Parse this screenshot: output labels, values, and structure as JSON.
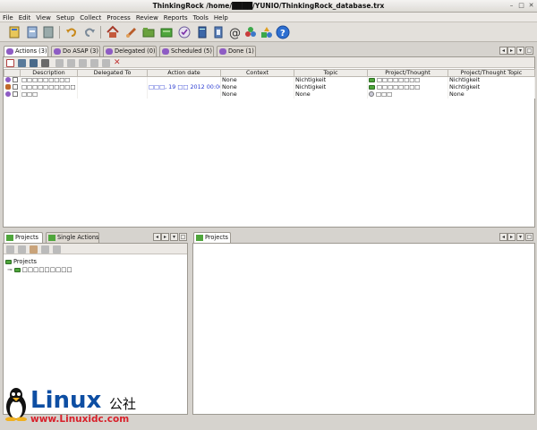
{
  "window": {
    "title": "ThinkingRock /home/████/YUNIO/ThinkingRock_database.trx"
  },
  "menu": [
    "File",
    "Edit",
    "View",
    "Setup",
    "Collect",
    "Process",
    "Review",
    "Reports",
    "Tools",
    "Help"
  ],
  "toolbar_icons": [
    "collect-thoughts-icon",
    "process-thoughts-icon",
    "review-actions-icon",
    "undo-icon",
    "redo-icon",
    "home-icon",
    "new-thought-icon",
    "folder-open-icon",
    "projects-icon",
    "checklist-icon",
    "book-icon",
    "email-icon",
    "contexts-icon",
    "shapes-icon",
    "help-icon"
  ],
  "action_tabs": [
    {
      "label": "Actions (3)",
      "active": true
    },
    {
      "label": "Do ASAP (3)",
      "active": false
    },
    {
      "label": "Delegated (0)",
      "active": false
    },
    {
      "label": "Scheduled (5)",
      "active": false
    },
    {
      "label": "Done (1)",
      "active": false
    }
  ],
  "columns": [
    "Description",
    "Delegated To",
    "Action date",
    "Context",
    "Topic",
    "Project/Thought",
    "Project/Thought Topic"
  ],
  "rows": [
    {
      "description": "□□□□□□□□□",
      "delegated_to": "",
      "action_date": "",
      "context": "None",
      "topic": "Nichtigkeit",
      "project": "□□□□□□□□",
      "project_topic": "Nichtigkeit"
    },
    {
      "description": "□□□□□□□□□□",
      "delegated_to": "",
      "action_date": "□□□, 19 □□ 2012 00:00",
      "context": "None",
      "topic": "Nichtigkeit",
      "project": "□□□□□□□□",
      "project_topic": "Nichtigkeit"
    },
    {
      "description": "□□□",
      "delegated_to": "",
      "action_date": "",
      "context": "None",
      "topic": "None",
      "project": "□□□",
      "project_topic": "None"
    }
  ],
  "bottom_left_tabs": [
    {
      "label": "Projects",
      "active": true
    },
    {
      "label": "Single Actions",
      "active": false
    }
  ],
  "bottom_right_tabs": [
    {
      "label": "Projects",
      "active": true
    }
  ],
  "project_tree": {
    "root": "Projects",
    "children": [
      "□□□□□□□□□"
    ]
  },
  "watermark": {
    "brand": "Linux",
    "suffix": "公社",
    "url": "www.Linuxidc.com"
  }
}
